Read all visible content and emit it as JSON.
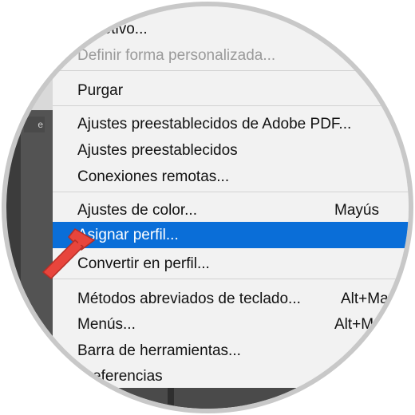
{
  "menu": {
    "items": [
      {
        "label": "...Motivo...",
        "shortcut": "",
        "state": "normal"
      },
      {
        "label": "Definir forma personalizada...",
        "shortcut": "",
        "state": "disabled"
      },
      {
        "label": "Purgar",
        "shortcut": "",
        "state": "normal"
      },
      {
        "label": "Ajustes preestablecidos de Adobe PDF...",
        "shortcut": "",
        "state": "normal"
      },
      {
        "label": "Ajustes preestablecidos",
        "shortcut": "",
        "state": "normal"
      },
      {
        "label": "Conexiones remotas...",
        "shortcut": "",
        "state": "normal"
      },
      {
        "label": "Ajustes de color...",
        "shortcut": "Mayús",
        "state": "normal"
      },
      {
        "label": "Asignar perfil...",
        "shortcut": "",
        "state": "selected"
      },
      {
        "label": "Convertir en perfil...",
        "shortcut": "",
        "state": "normal"
      },
      {
        "label": "Métodos abreviados de teclado...",
        "shortcut": "Alt+May",
        "state": "normal"
      },
      {
        "label": "Menús...",
        "shortcut": "Alt+M",
        "state": "normal"
      },
      {
        "label": "Barra de herramientas...",
        "shortcut": "",
        "state": "normal"
      },
      {
        "label": "Preferencias",
        "shortcut": "",
        "state": "normal"
      }
    ]
  },
  "left_panel": {
    "tab_label": "e"
  },
  "colors": {
    "selection": "#0a6ed8",
    "menu_bg": "#f2f2f2",
    "arrow": "#e8453c"
  }
}
